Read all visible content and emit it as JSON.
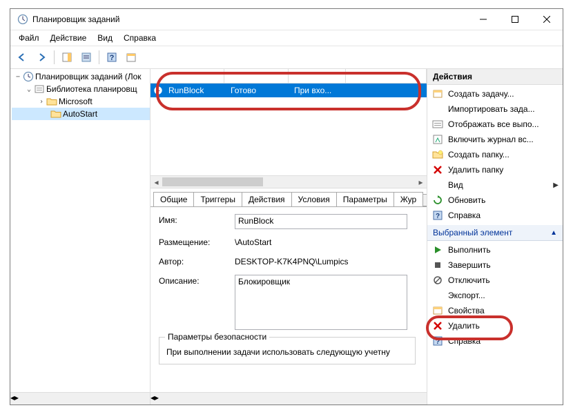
{
  "window": {
    "title": "Планировщик заданий"
  },
  "menus": {
    "file": "Файл",
    "action": "Действие",
    "view": "Вид",
    "help": "Справка"
  },
  "tree": {
    "root": "Планировщик заданий (Лок",
    "library": "Библиотека планировщ",
    "microsoft": "Microsoft",
    "autostart": "AutoStart"
  },
  "task": {
    "name": "RunBlock",
    "status": "Готово",
    "trigger": "При вхо..."
  },
  "tabs": {
    "general": "Общие",
    "triggers": "Триггеры",
    "actions": "Действия",
    "conditions": "Условия",
    "settings": "Параметры",
    "history": "Жур"
  },
  "general": {
    "name_label": "Имя:",
    "name_value": "RunBlock",
    "loc_label": "Размещение:",
    "loc_value": "\\AutoStart",
    "author_label": "Автор:",
    "author_value": "DESKTOP-K7K4PNQ\\Lumpics",
    "desc_label": "Описание:",
    "desc_value": "Блокировщик",
    "security_legend": "Параметры безопасности",
    "security_account": "При выполнении задачи использовать следующую учетну"
  },
  "actions_pane": {
    "header": "Действия",
    "section2": "Выбранный элемент",
    "create": "Создать задачу...",
    "import": "Импортировать зада...",
    "show_running": "Отображать все выпо...",
    "enable_log": "Включить журнал вс...",
    "new_folder": "Создать папку...",
    "delete_folder": "Удалить папку",
    "view": "Вид",
    "refresh": "Обновить",
    "help": "Справка",
    "run": "Выполнить",
    "end": "Завершить",
    "disable": "Отключить",
    "export": "Экспорт...",
    "properties": "Свойства",
    "delete": "Удалить",
    "help2": "Справка"
  }
}
